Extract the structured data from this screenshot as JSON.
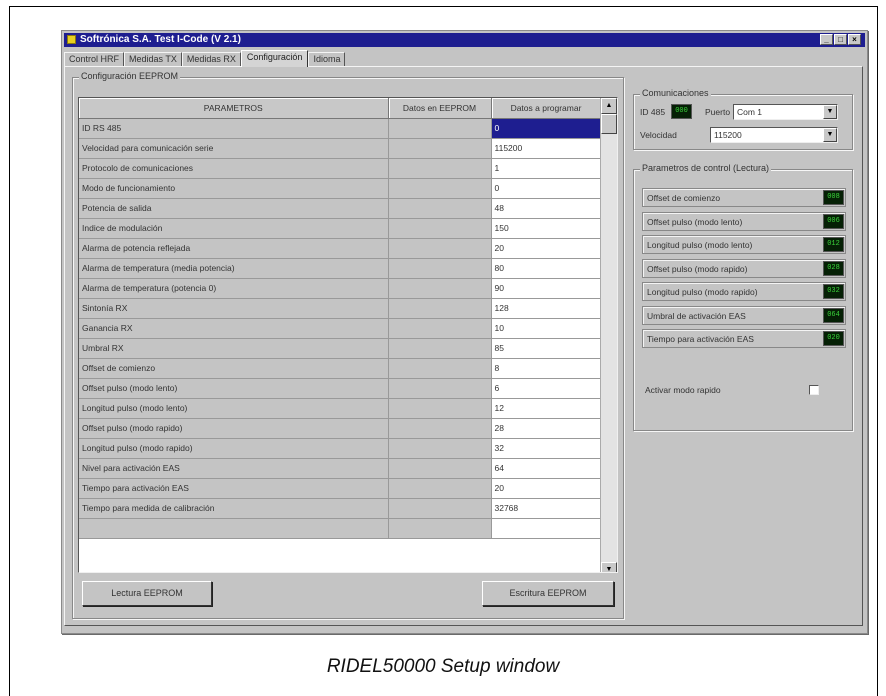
{
  "window": {
    "title": "Softrónica S.A. Test I-Code (V 2.1)",
    "buttons": [
      "_",
      "□",
      "×"
    ]
  },
  "tabs": [
    {
      "label": "Control HRF",
      "active": false
    },
    {
      "label": "Medidas TX",
      "active": false
    },
    {
      "label": "Medidas RX",
      "active": false
    },
    {
      "label": "Configuración",
      "active": true
    },
    {
      "label": "Idioma",
      "active": false
    }
  ],
  "eeprom": {
    "group_label": "Configuración EEPROM",
    "headers": [
      "PARAMETROS",
      "Datos en EEPROM",
      "Datos a programar"
    ],
    "rows": [
      {
        "param": "ID RS 485",
        "eeprom": "",
        "program": "0",
        "selected": true
      },
      {
        "param": "Velocidad para comunicación serie",
        "eeprom": "",
        "program": "115200"
      },
      {
        "param": "Protocolo de comunicaciones",
        "eeprom": "",
        "program": "1"
      },
      {
        "param": "Modo de funcionamiento",
        "eeprom": "",
        "program": "0"
      },
      {
        "param": "Potencia de salida",
        "eeprom": "",
        "program": "48"
      },
      {
        "param": "Indice de modulación",
        "eeprom": "",
        "program": "150"
      },
      {
        "param": "Alarma de potencia reflejada",
        "eeprom": "",
        "program": "20"
      },
      {
        "param": "Alarma de temperatura (media potencia)",
        "eeprom": "",
        "program": "80"
      },
      {
        "param": "Alarma de temperatura (potencia 0)",
        "eeprom": "",
        "program": "90"
      },
      {
        "param": "Sintonía RX",
        "eeprom": "",
        "program": "128"
      },
      {
        "param": "Ganancia RX",
        "eeprom": "",
        "program": "10"
      },
      {
        "param": "Umbral RX",
        "eeprom": "",
        "program": "85"
      },
      {
        "param": "Offset de comienzo",
        "eeprom": "",
        "program": "8"
      },
      {
        "param": "Offset pulso (modo lento)",
        "eeprom": "",
        "program": "6"
      },
      {
        "param": "Longitud pulso (modo lento)",
        "eeprom": "",
        "program": "12"
      },
      {
        "param": "Offset pulso (modo rapido)",
        "eeprom": "",
        "program": "28"
      },
      {
        "param": "Longitud pulso (modo rapido)",
        "eeprom": "",
        "program": "32"
      },
      {
        "param": "Nivel para activación EAS",
        "eeprom": "",
        "program": "64"
      },
      {
        "param": "Tiempo para activación EAS",
        "eeprom": "",
        "program": "20"
      },
      {
        "param": "Tiempo para medida de calibración",
        "eeprom": "",
        "program": "32768"
      },
      {
        "param": "",
        "eeprom": "",
        "program": ""
      }
    ],
    "read_button": "Lectura EEPROM",
    "write_button": "Escritura EEPROM"
  },
  "comms": {
    "group_label": "Comunicaciones",
    "id_label": "ID 485",
    "id_value": "000",
    "port_label": "Puerto",
    "port_value": "Com 1",
    "speed_label": "Velocidad",
    "speed_value": "115200"
  },
  "control": {
    "group_label": "Parametros de control (Lectura)",
    "items": [
      {
        "label": "Offset de comienzo",
        "value": "008"
      },
      {
        "label": "Offset pulso (modo lento)",
        "value": "006"
      },
      {
        "label": "Longitud pulso (modo lento)",
        "value": "012"
      },
      {
        "label": "Offset pulso (modo rapido)",
        "value": "028"
      },
      {
        "label": "Longitud pulso (modo rapido)",
        "value": "032"
      },
      {
        "label": "Umbral de activación EAS",
        "value": "064"
      },
      {
        "label": "Tiempo para activación EAS",
        "value": "020"
      }
    ],
    "fast_mode_label": "Activar modo rapido",
    "fast_mode_checked": false
  },
  "caption": "RIDEL50000 Setup window"
}
